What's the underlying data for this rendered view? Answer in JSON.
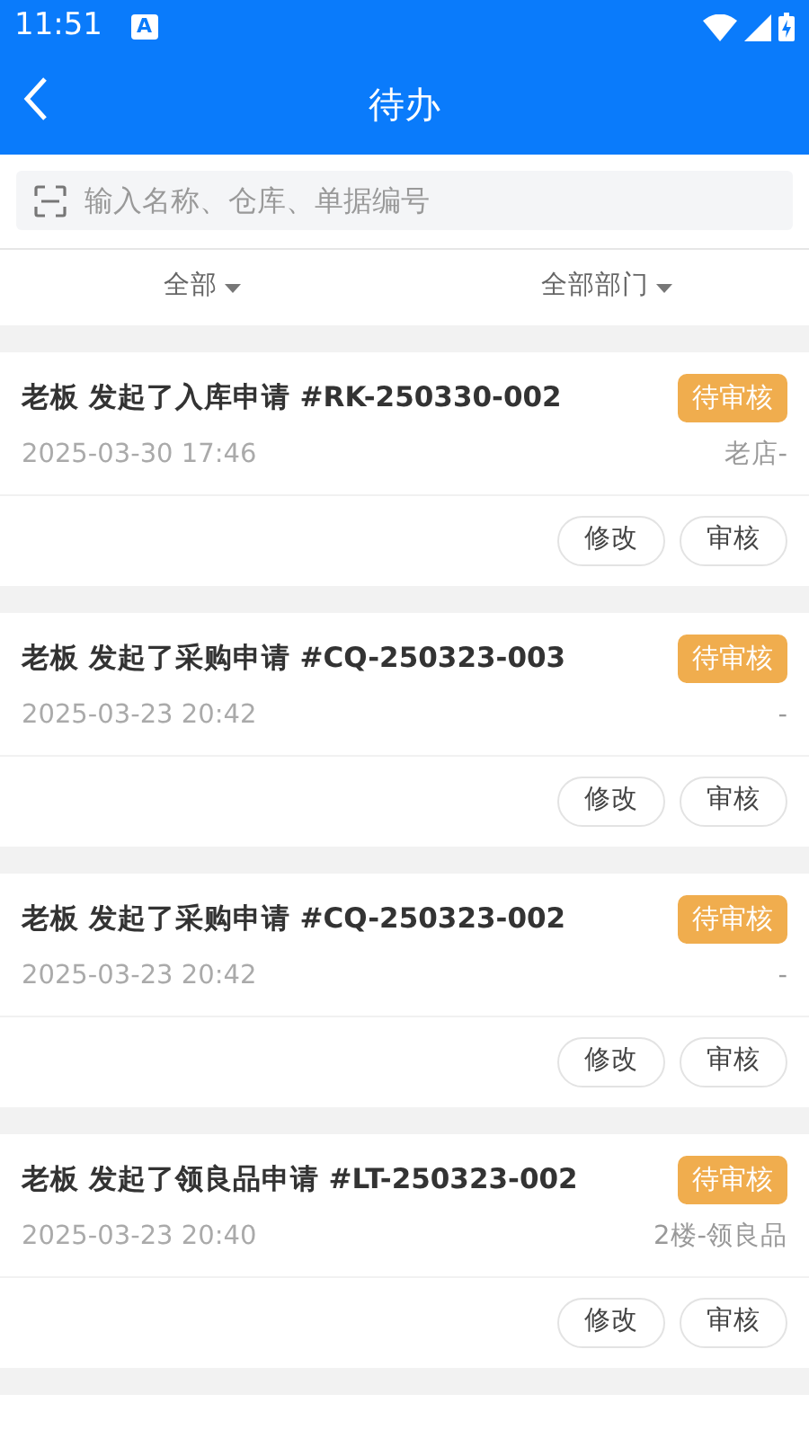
{
  "status_bar": {
    "time": "11:51",
    "notification": "A"
  },
  "header": {
    "title": "待办"
  },
  "search": {
    "placeholder": "输入名称、仓库、单据编号"
  },
  "filters": [
    {
      "label": "全部"
    },
    {
      "label": "全部部门"
    }
  ],
  "tasks": [
    {
      "title": "老板 发起了入库申请 #RK-250330-002",
      "status": "待审核",
      "date": "2025-03-30 17:46",
      "location": "老店-",
      "actions": [
        "修改",
        "审核"
      ]
    },
    {
      "title": "老板 发起了采购申请 #CQ-250323-003",
      "status": "待审核",
      "date": "2025-03-23 20:42",
      "location": "-",
      "actions": [
        "修改",
        "审核"
      ]
    },
    {
      "title": "老板 发起了采购申请 #CQ-250323-002",
      "status": "待审核",
      "date": "2025-03-23 20:42",
      "location": "-",
      "actions": [
        "修改",
        "审核"
      ]
    },
    {
      "title": "老板 发起了领良品申请 #LT-250323-002",
      "status": "待审核",
      "date": "2025-03-23 20:40",
      "location": "2楼-领良品",
      "actions": [
        "修改",
        "审核"
      ]
    }
  ]
}
